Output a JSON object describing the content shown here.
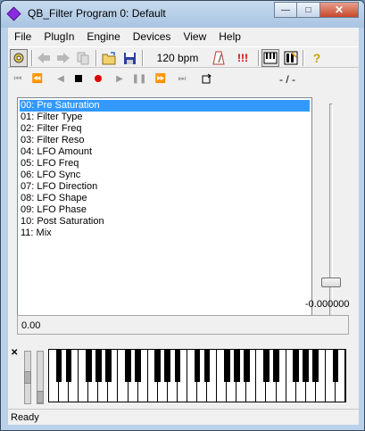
{
  "window": {
    "title": "QB_Filter Program 0: Default"
  },
  "menu": [
    "File",
    "PlugIn",
    "Engine",
    "Devices",
    "View",
    "Help"
  ],
  "toolbar": {
    "tempo": "120 bpm",
    "warning": "!!!",
    "help": "?"
  },
  "transport": {
    "position": "- / -"
  },
  "parameters": [
    "00: Pre Saturation",
    "01: Filter Type",
    "02: Filter Freq",
    "03: Filter Reso",
    "04: LFO Amount",
    "05: LFO Freq",
    "06: LFO Sync",
    "07: LFO Direction",
    "08: LFO Shape",
    "09: LFO Phase",
    "10: Post Saturation",
    "11: Mix"
  ],
  "selected_parameter_index": 0,
  "slider": {
    "value": "-0.000000"
  },
  "value_field": "0.00",
  "status": "Ready",
  "icons": [
    "settings-icon",
    "back-arrow-icon",
    "forward-arrow-icon",
    "copy-icon",
    "open-folder-icon",
    "save-icon",
    "metronome-icon",
    "keyboard-icon",
    "edit-icon",
    "help-icon"
  ],
  "colors": {
    "selection": "#3399ff",
    "titlebar": "#b9d1ea",
    "close_button": "#c8472d"
  }
}
